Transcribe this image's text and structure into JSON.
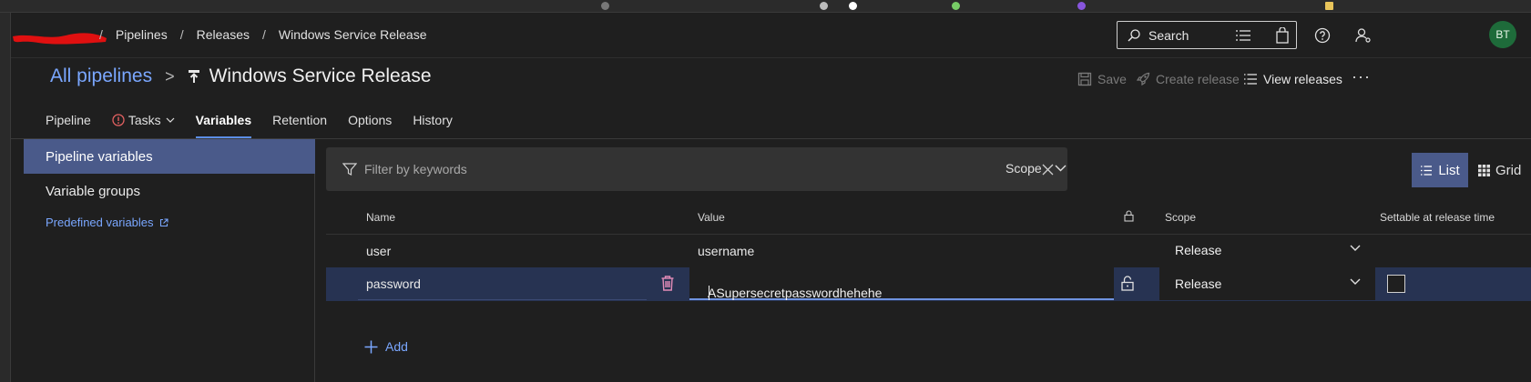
{
  "breadcrumb": {
    "items": [
      "Pipelines",
      "Releases",
      "Windows Service Release"
    ],
    "separator": "/"
  },
  "header": {
    "search_placeholder": "Search",
    "avatar_initials": "BT"
  },
  "page": {
    "all_pipelines": "All pipelines",
    "chevron": ">",
    "title": "Windows Service Release"
  },
  "actions": {
    "save": "Save",
    "create_release": "Create release",
    "view_releases": "View releases",
    "more": "···"
  },
  "tabs": [
    {
      "label": "Pipeline"
    },
    {
      "label": "Tasks"
    },
    {
      "label": "Variables"
    },
    {
      "label": "Retention"
    },
    {
      "label": "Options"
    },
    {
      "label": "History"
    }
  ],
  "sidebar": {
    "items": [
      {
        "label": "Pipeline variables",
        "selected": true
      },
      {
        "label": "Variable groups",
        "selected": false
      }
    ],
    "link": "Predefined variables"
  },
  "filter": {
    "placeholder": "Filter by keywords",
    "scope_label": "Scope"
  },
  "views": {
    "list": "List",
    "grid": "Grid"
  },
  "table": {
    "columns": {
      "name": "Name",
      "value": "Value",
      "scope": "Scope",
      "settable": "Settable at release time"
    },
    "rows": [
      {
        "name": "user",
        "value": "username",
        "scope": "Release"
      },
      {
        "name": "password",
        "value": "ASupersecretpasswordhehehe",
        "scope": "Release"
      }
    ]
  },
  "add_label": "Add",
  "colors": {
    "accent": "#5c8ee6",
    "link": "#7aa7ff",
    "selected_bg": "#4a5a8a",
    "row_selected_bg": "#273352",
    "avatar_bg": "#1e6b3a",
    "warning": "#e06060",
    "delete_icon": "#e38cb8"
  }
}
